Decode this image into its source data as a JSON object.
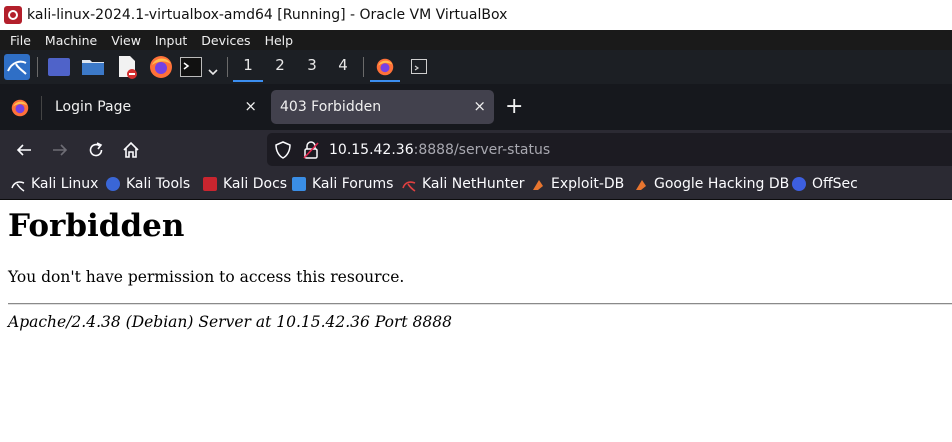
{
  "vbox": {
    "title": "kali-linux-2024.1-virtualbox-amd64 [Running] - Oracle VM VirtualBox",
    "menu": [
      "File",
      "Machine",
      "View",
      "Input",
      "Devices",
      "Help"
    ]
  },
  "panel": {
    "workspaces": [
      "1",
      "2",
      "3",
      "4"
    ],
    "active_workspace": "1"
  },
  "tabs": [
    {
      "label": "Login Page",
      "close": "×"
    },
    {
      "label": "403 Forbidden",
      "close": "×"
    }
  ],
  "new_tab": "+",
  "url": {
    "host": "10.15.42.36",
    "rest": ":8888/server-status"
  },
  "bookmarks": [
    "Kali Linux",
    "Kali Tools",
    "Kali Docs",
    "Kali Forums",
    "Kali NetHunter",
    "Exploit-DB",
    "Google Hacking DB",
    "OffSec"
  ],
  "page": {
    "heading": "Forbidden",
    "message": "You don't have permission to access this resource.",
    "address": "Apache/2.4.38 (Debian) Server at 10.15.42.36 Port 8888"
  },
  "colors": {
    "accent": "#3b8ef0",
    "page_bg": "#ffffff",
    "toolbar_bg": "#2b2a33"
  }
}
